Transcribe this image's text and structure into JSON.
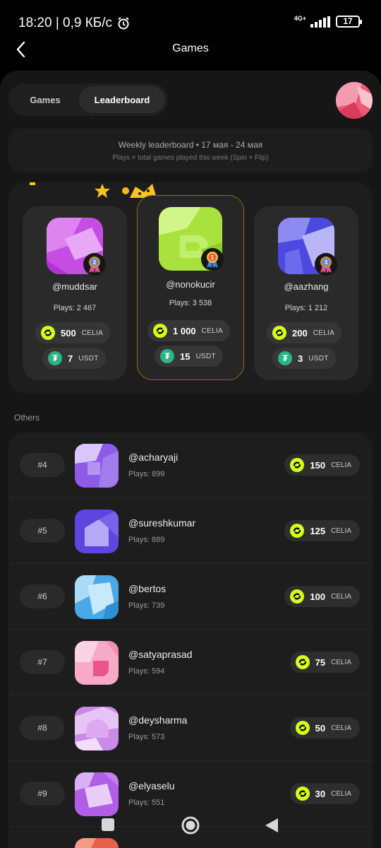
{
  "status": {
    "time_speed": "18:20 | 0,9 КБ/с",
    "network": "4G+",
    "battery": "17"
  },
  "header": {
    "title": "Games"
  },
  "tabs": {
    "games": "Games",
    "leaderboard": "Leaderboard"
  },
  "info": {
    "title": "Weekly leaderboard • 17 мая - 24 мая",
    "subtitle": "Plays = total games played this week (Spin + Flip)"
  },
  "podium": {
    "second": {
      "rank": "2",
      "username": "@muddsar",
      "plays": "Plays: 2 467",
      "celia": "500",
      "usdt": "7"
    },
    "first": {
      "rank": "1",
      "username": "@nonokucir",
      "plays": "Plays: 3 538",
      "celia": "1 000",
      "usdt": "15"
    },
    "third": {
      "rank": "3",
      "username": "@aazhang",
      "plays": "Plays: 1 212",
      "celia": "200",
      "usdt": "3"
    },
    "celia_label": "CELIA",
    "usdt_label": "USDT"
  },
  "others_label": "Others",
  "others": [
    {
      "rank": "#4",
      "username": "@acharyaji",
      "plays": "Plays: 899",
      "celia": "150",
      "cur": "CELIA"
    },
    {
      "rank": "#5",
      "username": "@sureshkumar",
      "plays": "Plays: 889",
      "celia": "125",
      "cur": "CELIA"
    },
    {
      "rank": "#6",
      "username": "@bertos",
      "plays": "Plays: 739",
      "celia": "100",
      "cur": "CELIA"
    },
    {
      "rank": "#7",
      "username": "@satyaprasad",
      "plays": "Plays: 594",
      "celia": "75",
      "cur": "CELIA"
    },
    {
      "rank": "#8",
      "username": "@deysharma",
      "plays": "Plays: 573",
      "celia": "50",
      "cur": "CELIA"
    },
    {
      "rank": "#9",
      "username": "@elyaselu",
      "plays": "Plays: 551",
      "celia": "30",
      "cur": "CELIA"
    }
  ],
  "colors": {
    "accent_celia": "#d4ff1e",
    "usdt": "#2bb486",
    "gold_border": "#8b6d1d"
  }
}
